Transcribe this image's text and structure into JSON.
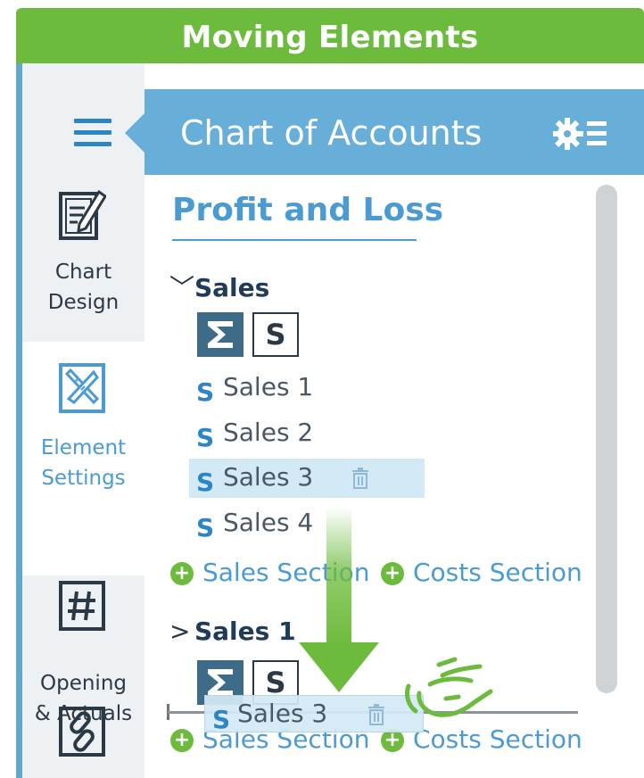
{
  "banner": {
    "title": "Moving Elements"
  },
  "sidebar": {
    "menu_icon": "hamburger-icon",
    "items": [
      {
        "label_line1": "Chart",
        "label_line2": "Design",
        "icon": "edit-document-icon",
        "active": false
      },
      {
        "label_line1": "Element",
        "label_line2": "Settings",
        "icon": "ruler-pencil-icon",
        "active": true
      },
      {
        "label_line1": "Opening",
        "label_line2": "& Actuals",
        "icon": "hash-icon",
        "active": false
      },
      {
        "label_line1": "",
        "label_line2": "",
        "icon": "link-icon",
        "active": false
      }
    ]
  },
  "header": {
    "title": "Chart of Accounts",
    "settings_icon": "gear-list-icon"
  },
  "page": {
    "title": "Profit and Loss"
  },
  "sections": [
    {
      "name": "Sales",
      "expanded": true,
      "sum_label": "Σ",
      "s_label": "S",
      "items": [
        {
          "marker": "S",
          "label": "Sales 1"
        },
        {
          "marker": "S",
          "label": "Sales 2"
        },
        {
          "marker": "S",
          "label": "Sales 3",
          "selected": true
        },
        {
          "marker": "S",
          "label": "Sales 4"
        }
      ],
      "add_links": [
        "Sales Section",
        "Costs Section"
      ]
    },
    {
      "name": "Sales 1",
      "expanded": false,
      "sum_label": "Σ",
      "s_label": "S",
      "add_links": [
        "Sales Section",
        "Costs Section"
      ]
    }
  ],
  "drag": {
    "marker": "S",
    "label": "Sales 3",
    "arrow_color": "#6cbb3c",
    "hand_icon": "drag-hand-icon"
  },
  "colors": {
    "banner": "#6cbb3c",
    "header": "#67aed8",
    "accent": "#4b9bd2",
    "selected": "#d4e9f6"
  }
}
